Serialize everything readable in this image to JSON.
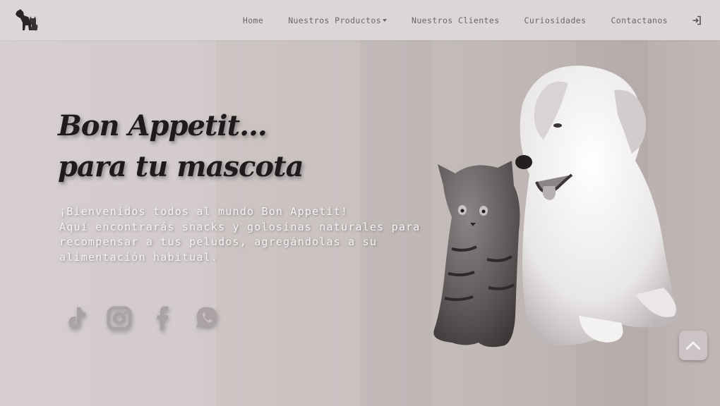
{
  "nav": {
    "links": [
      {
        "label": "Home"
      },
      {
        "label": "Nuestros Productos"
      },
      {
        "label": "Nuestros Clientes"
      },
      {
        "label": "Curiosidades"
      },
      {
        "label": "Contactanos"
      }
    ],
    "login_icon": "sign-in-icon",
    "logo_icon": "dog-cat-logo"
  },
  "hero": {
    "title_line1": "Bon Appetit...",
    "title_line2": "para tu mascota",
    "text_line1": "¡Bienvenidos todos al mundo Bon Appetit!",
    "text_line2": "Aquí encontrarás snacks y golosinas naturales para",
    "text_line3": "recompensar a tus peludos, agregándolas a su",
    "text_line4": "alimentación habitual."
  },
  "socials": [
    {
      "icon": "tiktok-icon"
    },
    {
      "icon": "instagram-icon"
    },
    {
      "icon": "facebook-icon"
    },
    {
      "icon": "whatsapp-icon"
    }
  ],
  "back_to_top_icon": "chevron-up-icon",
  "colors": {
    "navbar_bg": "#dcd6d6",
    "nav_text": "#6b6767",
    "title": "#1f1b1b",
    "hero_text": "#f6f3f3"
  }
}
